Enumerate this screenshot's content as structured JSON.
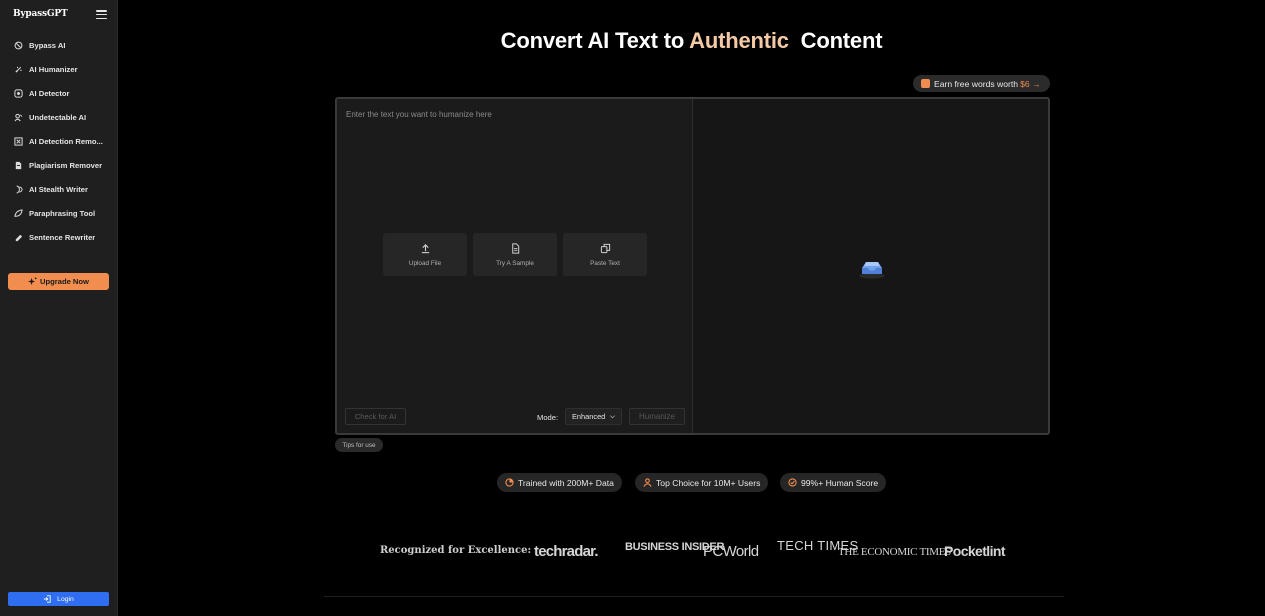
{
  "app": {
    "brand": "BypassGPT"
  },
  "sidebar": {
    "items": [
      {
        "label": "Bypass AI",
        "icon": "bypass-icon"
      },
      {
        "label": "AI Humanizer",
        "icon": "humanizer-icon"
      },
      {
        "label": "AI Detector",
        "icon": "detector-icon"
      },
      {
        "label": "Undetectable AI",
        "icon": "undetectable-icon"
      },
      {
        "label": "AI Detection Remo...",
        "icon": "detection-remover-icon"
      },
      {
        "label": "Plagiarism Remover",
        "icon": "plagiarism-icon"
      },
      {
        "label": "AI Stealth Writer",
        "icon": "stealth-writer-icon"
      },
      {
        "label": "Paraphrasing Tool",
        "icon": "paraphrase-icon"
      },
      {
        "label": "Sentence Rewriter",
        "icon": "rewriter-icon"
      }
    ],
    "upgrade_label": "Upgrade Now",
    "login_label": "Login"
  },
  "header": {
    "title_part1": "Convert AI Text to ",
    "title_highlight": "Authentic",
    "title_part2": "  Content",
    "earn_text": "Earn free words worth",
    "earn_amount": "$6 →"
  },
  "editor": {
    "placeholder": "Enter the text you want to humanize here",
    "actions": [
      {
        "label": "Upload File",
        "icon": "upload-icon"
      },
      {
        "label": "Try A Sample",
        "icon": "document-icon"
      },
      {
        "label": "Paste Text",
        "icon": "copy-icon"
      }
    ],
    "check_ai_label": "Check for AI",
    "mode_label": "Mode:",
    "mode_value": "Enhanced",
    "humanize_label": "Humanize"
  },
  "tips_label": "Tips for use",
  "badges": [
    {
      "label": "Trained with 200M+ Data",
      "icon": "chart-icon"
    },
    {
      "label": "Top Choice for 10M+ Users",
      "icon": "users-icon"
    },
    {
      "label": "99%+ Human Score",
      "icon": "check-circle-icon"
    }
  ],
  "recognized": {
    "label": "Recognized for Excellence:",
    "logos": [
      "techradar.",
      "BUSINESS INSIDER",
      "PCWorld",
      "TECH TIMES",
      "THE ECONOMIC TIMES",
      "Pocketlint"
    ]
  },
  "colors": {
    "accent": "#f08d4f",
    "highlight": "#f4c9a5",
    "login": "#2f6ef0"
  }
}
